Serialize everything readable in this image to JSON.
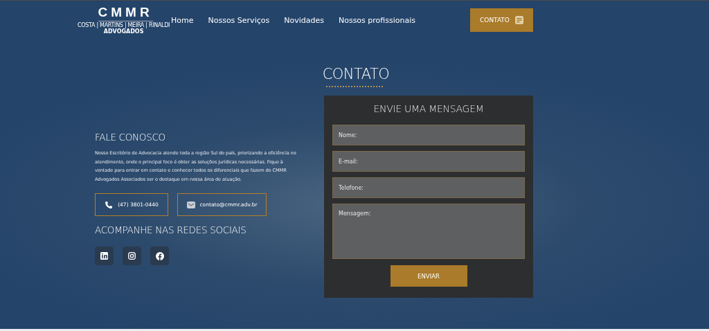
{
  "header": {
    "logo": {
      "name": "CMMR",
      "partners": "COSTA | MARTINS | MEIRA | RINALDI",
      "firm": "ADVOGADOS"
    },
    "nav": [
      {
        "label": "Home"
      },
      {
        "label": "Nossos Serviços"
      },
      {
        "label": "Novidades"
      },
      {
        "label": "Nossos profissionais"
      }
    ],
    "cta": "CONTATO"
  },
  "page_title": "CONTATO",
  "info": {
    "heading": "FALE CONOSCO",
    "text": "Nosso Escritório de Advocacia atende toda a região Sul do país, priorizando a eficiência no atendimento, onde o principal foco é obter as soluções jurídicas necessárias. Fique à vontade para entrar em contato e conhecer todos os diferenciais que fazem do CMMR Advogados Associados ser o destaque em nossa área de atuação.",
    "contacts": [
      {
        "kind": "phone",
        "label": "(47) 3801-0440"
      },
      {
        "kind": "email",
        "label": "contato@cmmr.adv.br"
      }
    ],
    "social_heading": "ACOMPANHE NAS REDES SOCIAIS",
    "social": [
      {
        "kind": "linkedin"
      },
      {
        "kind": "instagram"
      },
      {
        "kind": "facebook"
      }
    ]
  },
  "form": {
    "title": "ENVIE UMA MENSAGEM",
    "fields": [
      {
        "kind": "input",
        "placeholder": "Nome:"
      },
      {
        "kind": "input",
        "placeholder": "E-mail:"
      },
      {
        "kind": "input",
        "placeholder": "Telefone:"
      },
      {
        "kind": "textarea",
        "placeholder": "Mensagem:"
      }
    ],
    "submit": "ENVIAR"
  }
}
